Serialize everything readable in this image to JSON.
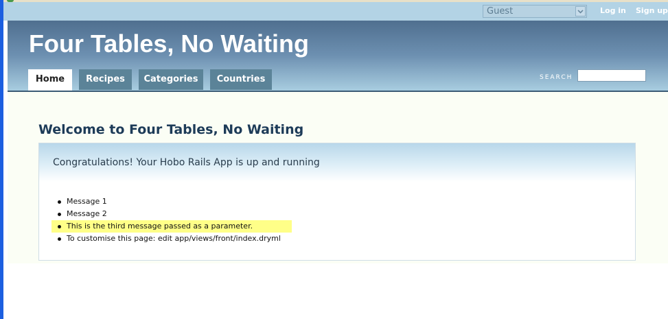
{
  "account_bar": {
    "user_select": {
      "selected": "Guest"
    },
    "login": "Log in",
    "signup": "Sign up"
  },
  "header": {
    "app_name": "Four Tables, No Waiting",
    "nav": [
      {
        "label": "Home",
        "active": true
      },
      {
        "label": "Recipes"
      },
      {
        "label": "Categories"
      },
      {
        "label": "Countries"
      }
    ],
    "search": {
      "label": "SEARCH",
      "value": ""
    }
  },
  "main": {
    "heading": "Welcome to Four Tables, No Waiting",
    "panel": {
      "title": "Congratulations! Your Hobo Rails App is up and running",
      "messages": [
        {
          "text": "Message 1",
          "highlighted": false
        },
        {
          "text": "Message 2",
          "highlighted": false
        },
        {
          "text": "This is the third message passed as a parameter.",
          "highlighted": true
        },
        {
          "text": "To customise this page: edit app/views/front/index.dryml",
          "highlighted": false
        }
      ]
    }
  },
  "colors": {
    "account_bar": "#b3d3e5",
    "tab": "#5b8398",
    "heading": "#1d3b58",
    "highlight": "#ffff88"
  },
  "icons": {
    "select_arrow": "chevron-down-icon"
  }
}
